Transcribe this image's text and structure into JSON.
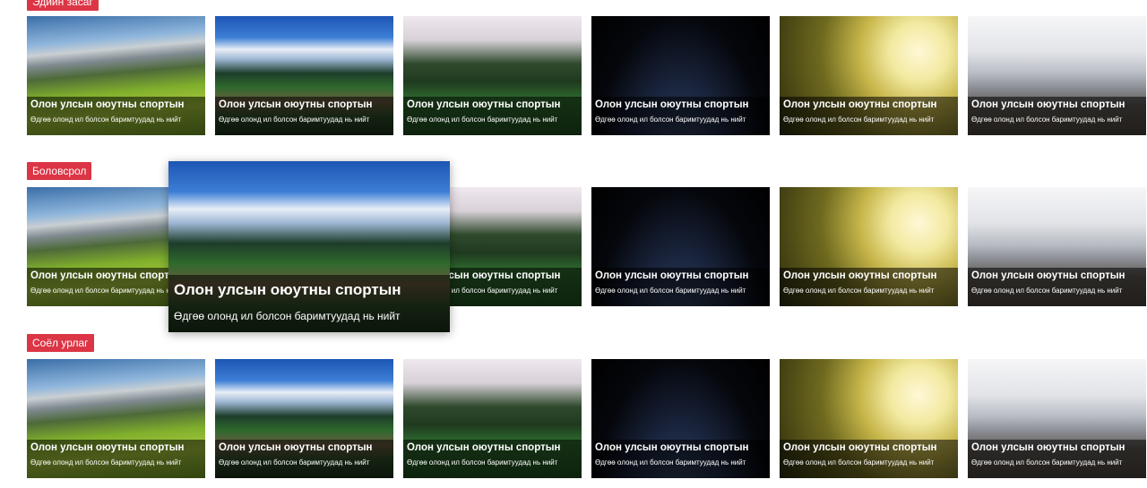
{
  "sections": [
    {
      "tag": "Эдийн засаг"
    },
    {
      "tag": "Боловсрол"
    },
    {
      "tag": "Соёл урлаг"
    }
  ],
  "card": {
    "title": "Олон улсын оюутны спортын",
    "subtitle": "Өдгөө олонд ил болсон баримтуудад нь нийт"
  },
  "scenes": [
    "valley",
    "lake",
    "forest",
    "earth",
    "mushroom",
    "bear"
  ],
  "popup": {
    "title": "Олон улсын оюутны спортын",
    "subtitle": "Өдгөө олонд ил болсон баримтуудад нь нийт"
  },
  "colors": {
    "tag_bg": "#dc3545"
  }
}
